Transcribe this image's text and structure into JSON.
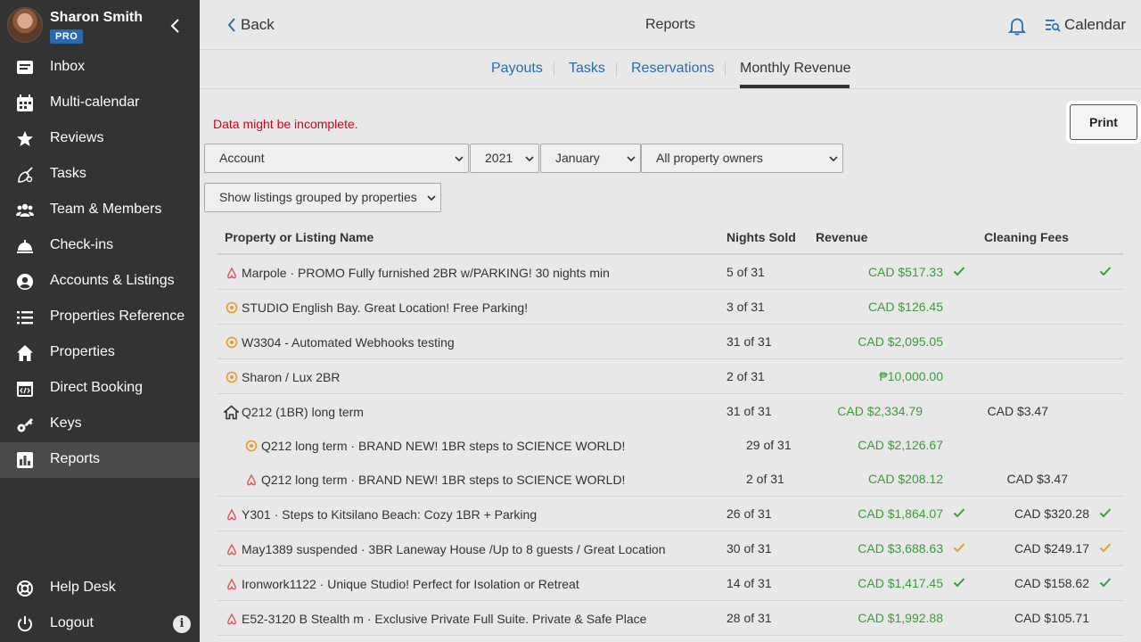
{
  "sidebar": {
    "user_name": "Sharon Smith",
    "badge": "PRO",
    "items": [
      {
        "label": "Inbox",
        "icon": "inbox-icon"
      },
      {
        "label": "Multi-calendar",
        "icon": "calendar-icon"
      },
      {
        "label": "Reviews",
        "icon": "star-icon"
      },
      {
        "label": "Tasks",
        "icon": "broom-icon"
      },
      {
        "label": "Team & Members",
        "icon": "team-icon"
      },
      {
        "label": "Check-ins",
        "icon": "bell-concierge-icon"
      },
      {
        "label": "Accounts & Listings",
        "icon": "user-circle-icon"
      },
      {
        "label": "Properties Reference",
        "icon": "list-icon"
      },
      {
        "label": "Properties",
        "icon": "home-icon"
      },
      {
        "label": "Direct Booking",
        "icon": "code-calendar-icon"
      },
      {
        "label": "Keys",
        "icon": "key-icon"
      },
      {
        "label": "Reports",
        "icon": "chart-icon"
      }
    ],
    "help_desk": "Help Desk",
    "logout": "Logout",
    "info": "i"
  },
  "header": {
    "back": "Back",
    "title": "Reports",
    "calendar": "Calendar"
  },
  "tabs": [
    "Payouts",
    "Tasks",
    "Reservations",
    "Monthly Revenue"
  ],
  "warning": "Data might be incomplete.",
  "print": "Print",
  "filters": {
    "account": "Account",
    "year": "2021",
    "month": "January",
    "owners": "All property owners",
    "grouping": "Show listings grouped by properties"
  },
  "table": {
    "headers": [
      "Property or Listing Name",
      "Nights Sold",
      "Revenue",
      "Cleaning Fees"
    ],
    "rows": [
      {
        "name": "Marpole · PROMO Fully furnished 2BR w/PARKING! 30 nights min",
        "nights": "5 of 31",
        "revenue": "CAD $517.33",
        "cleaning": ""
      },
      {
        "name": "STUDIO English Bay. Great Location! Free Parking!",
        "nights": "3 of 31",
        "revenue": "CAD $126.45",
        "cleaning": ""
      },
      {
        "name": "W3304 - Automated Webhooks testing",
        "nights": "31 of 31",
        "revenue": "CAD $2,095.05",
        "cleaning": ""
      },
      {
        "name": "Sharon / Lux 2BR",
        "nights": "2 of 31",
        "revenue": "₱10,000.00",
        "cleaning": ""
      },
      {
        "name": "Q212 (1BR) long term",
        "nights": "31 of 31",
        "revenue": "CAD $2,334.79",
        "cleaning": "CAD $3.47"
      },
      {
        "name": "Q212 long term · BRAND NEW! 1BR steps to SCIENCE WORLD!",
        "nights": "29 of 31",
        "revenue": "CAD $2,126.67",
        "cleaning": ""
      },
      {
        "name": "Q212 long term · BRAND NEW! 1BR steps to SCIENCE WORLD!",
        "nights": "2 of 31",
        "revenue": "CAD $208.12",
        "cleaning": "CAD $3.47"
      },
      {
        "name": "Y301 · Steps to Kitsilano Beach: Cozy 1BR + Parking",
        "nights": "26 of 31",
        "revenue": "CAD $1,864.07",
        "cleaning": "CAD $320.28"
      },
      {
        "name": "May1389 suspended · 3BR Laneway House /Up to 8 guests / Great Location",
        "nights": "30 of 31",
        "revenue": "CAD $3,688.63",
        "cleaning": "CAD $249.17"
      },
      {
        "name": "Ironwork1122 · Unique Studio! Perfect for Isolation or Retreat",
        "nights": "14 of 31",
        "revenue": "CAD $1,417.45",
        "cleaning": "CAD $158.62"
      },
      {
        "name": "E52-3120 B Stealth m · Exclusive Private Full Suite. Private & Safe Place",
        "nights": "28 of 31",
        "revenue": "CAD $1,992.88",
        "cleaning": "CAD $105.71"
      }
    ]
  },
  "colors": {
    "sidebar_bg": "#333333",
    "link_blue": "#2a6bb0",
    "revenue_green": "#3a9d3a",
    "check_green": "#3a9d3a",
    "check_orange": "#e0a030",
    "warning_red": "#d0021b",
    "airbnb_red": "#e0565b",
    "booking_orange": "#e89a2c"
  }
}
